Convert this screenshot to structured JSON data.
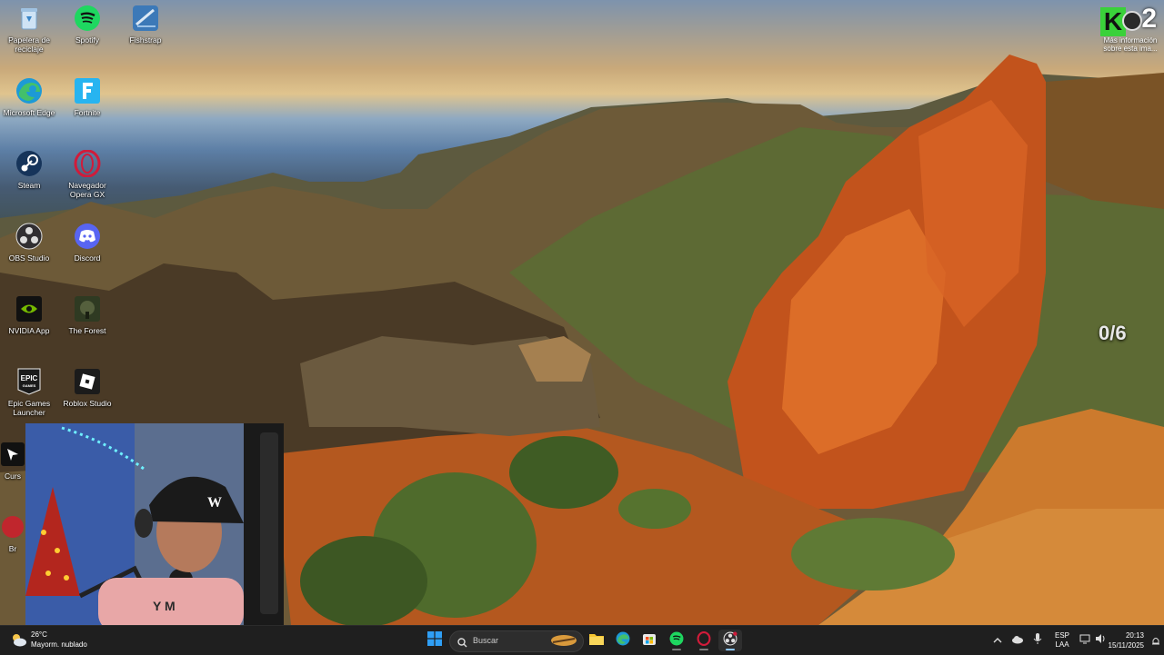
{
  "desktop": {
    "icons": [
      {
        "label": "Papelera de reciclaje",
        "icon": "recycle-bin-icon",
        "color": "#8fb4d9"
      },
      {
        "label": "Spotify",
        "icon": "spotify-icon",
        "color": "#1ed760"
      },
      {
        "label": "Fishstrap",
        "icon": "fishstrap-icon",
        "color": "#3c79b8"
      },
      {
        "label": "Microsoft Edge",
        "icon": "edge-icon",
        "color": "#1d9ad6"
      },
      {
        "label": "Fortnite",
        "icon": "fortnite-icon",
        "color": "#27b4f0"
      },
      {
        "label": "Steam",
        "icon": "steam-icon",
        "color": "#16345a"
      },
      {
        "label": "Navegador Opera GX",
        "icon": "opera-gx-icon",
        "color": "#d11b3a"
      },
      {
        "label": "OBS Studio",
        "icon": "obs-icon",
        "color": "#302e31"
      },
      {
        "label": "Discord",
        "icon": "discord-icon",
        "color": "#5865f2"
      },
      {
        "label": "NVIDIA App",
        "icon": "nvidia-icon",
        "color": "#76b900"
      },
      {
        "label": "The Forest",
        "icon": "the-forest-icon",
        "color": "#2f3a22"
      },
      {
        "label": "Epic Games Launcher",
        "icon": "epic-games-icon",
        "color": "#1a1a1a"
      },
      {
        "label": "Roblox Studio",
        "icon": "roblox-studio-icon",
        "color": "#1b1b1b"
      },
      {
        "label": "Curs",
        "icon": "cursor-app-icon",
        "color": "#111111"
      },
      {
        "label": "Br",
        "icon": "browser-app-icon",
        "color": "#c0262d"
      }
    ]
  },
  "overlay": {
    "brand_number": "2",
    "brand_letter": "K",
    "info_text": "Más información sobre esta ima...",
    "counter": "0/6"
  },
  "taskbar": {
    "weather_temp": "26°C",
    "weather_condition": "Mayorm. nublado",
    "search_placeholder": "Buscar",
    "language_top": "ESP",
    "language_bottom": "LAA",
    "time": "20:13",
    "date": "15/11/2025",
    "pinned": [
      {
        "name": "file-explorer-icon",
        "color": "#f4c430"
      },
      {
        "name": "edge-taskbar-icon",
        "color": "#1d9ad6"
      },
      {
        "name": "microsoft-store-icon",
        "color": "#e8e8e8"
      },
      {
        "name": "spotify-taskbar-icon",
        "color": "#1ed760"
      },
      {
        "name": "opera-gx-taskbar-icon",
        "color": "#d11b3a"
      },
      {
        "name": "obs-taskbar-icon",
        "color": "#e0e0e0"
      }
    ]
  },
  "colors": {
    "taskbar_bg": "#1f1f1f",
    "windows_blue": "#2f9ff5",
    "brand_green": "#3ad13a"
  }
}
